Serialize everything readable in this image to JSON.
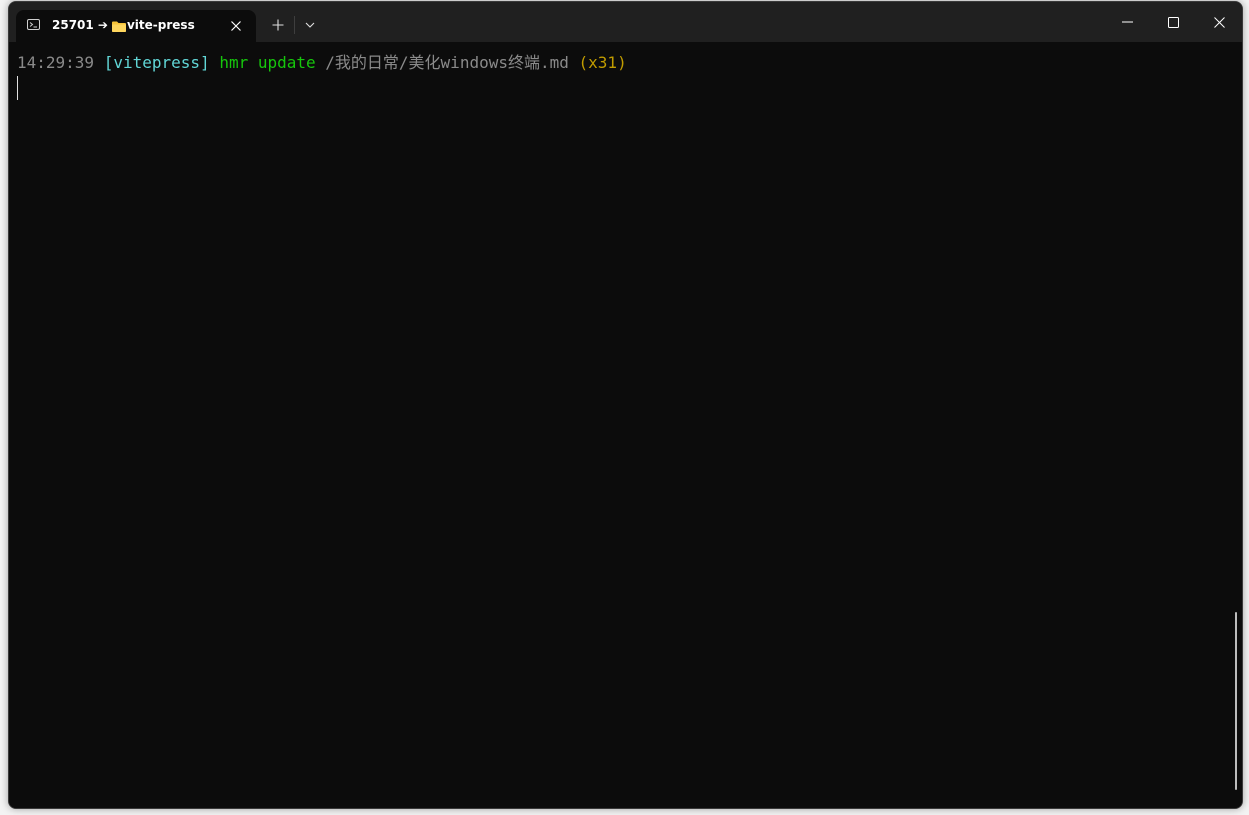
{
  "tab": {
    "title_prefix": "25701 ➔ ",
    "title_suffix": "vite-press",
    "icon": "terminal-icon",
    "close_label": "✕"
  },
  "titlebar": {
    "new_tab_label": "+",
    "dropdown_icon": "chevron-down-icon",
    "minimize_icon": "minimize-icon",
    "maximize_icon": "maximize-icon",
    "close_icon": "close-icon"
  },
  "terminal": {
    "line1": {
      "time": "14:29:39",
      "tag": "[vitepress]",
      "action": "hmr update",
      "path": "/我的日常/美化windows终端.md",
      "count": "(x31)"
    }
  },
  "colors": {
    "background": "#0c0c0c",
    "titlebar": "#202020",
    "time": "#8a8a8a",
    "tag": "#61d6d6",
    "action": "#16c60c",
    "count": "#c19c00"
  }
}
